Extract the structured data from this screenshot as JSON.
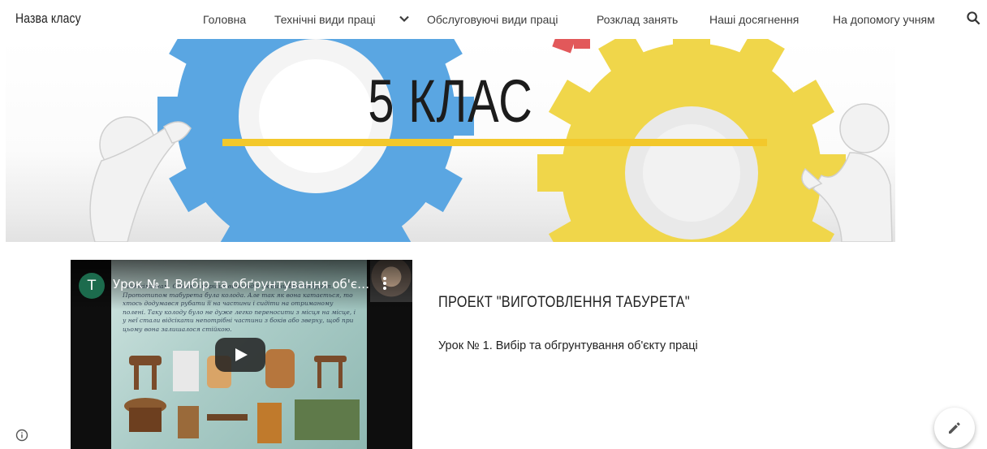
{
  "header": {
    "site_title": "Назва класу",
    "nav": [
      {
        "label": "Головна"
      },
      {
        "label": "Технічні види праці",
        "has_dropdown": true
      },
      {
        "label": "Обслуговуючі види праці"
      },
      {
        "label": "Розклад занять"
      },
      {
        "label": "Наші досягнення"
      },
      {
        "label": "На допомогу учням"
      }
    ],
    "icons": {
      "dropdown": "chevron-down-icon",
      "search": "search-icon"
    }
  },
  "banner": {
    "title": "5 КЛАС",
    "colors": {
      "underline": "#f3c82b",
      "gear_blue": "#5aa6e2",
      "gear_yellow": "#f0d64a",
      "gear_red": "#e2585a"
    }
  },
  "video": {
    "channel_initial": "T",
    "title": "Урок № 1 Вибір та обґрунтування об'єк...",
    "slide_text": "і відокімиінам. Одним з перших винаходів людини був табурет. Прототипом табурета була колода. Але так як вона катається, то хтось додумався рубати її на частини і сидіти на отриманому полені. Таку колоду було не дуже легко переносити з місця на місце, і у неї стали відсікати непотрібні частини з боків або зверху, щоб при цьому вона залишалося стійкою.",
    "icons": {
      "play": "play-icon",
      "menu": "more-vert-icon"
    }
  },
  "content": {
    "heading": "ПРОЕКТ \"ВИГОТОВЛЕННЯ ТАБУРЕТА\"",
    "lesson": "Урок № 1. Вибір та обгрунтування об'єкту праці"
  },
  "footer": {
    "icons": {
      "info": "info-icon",
      "edit": "edit-pencil-icon"
    }
  }
}
